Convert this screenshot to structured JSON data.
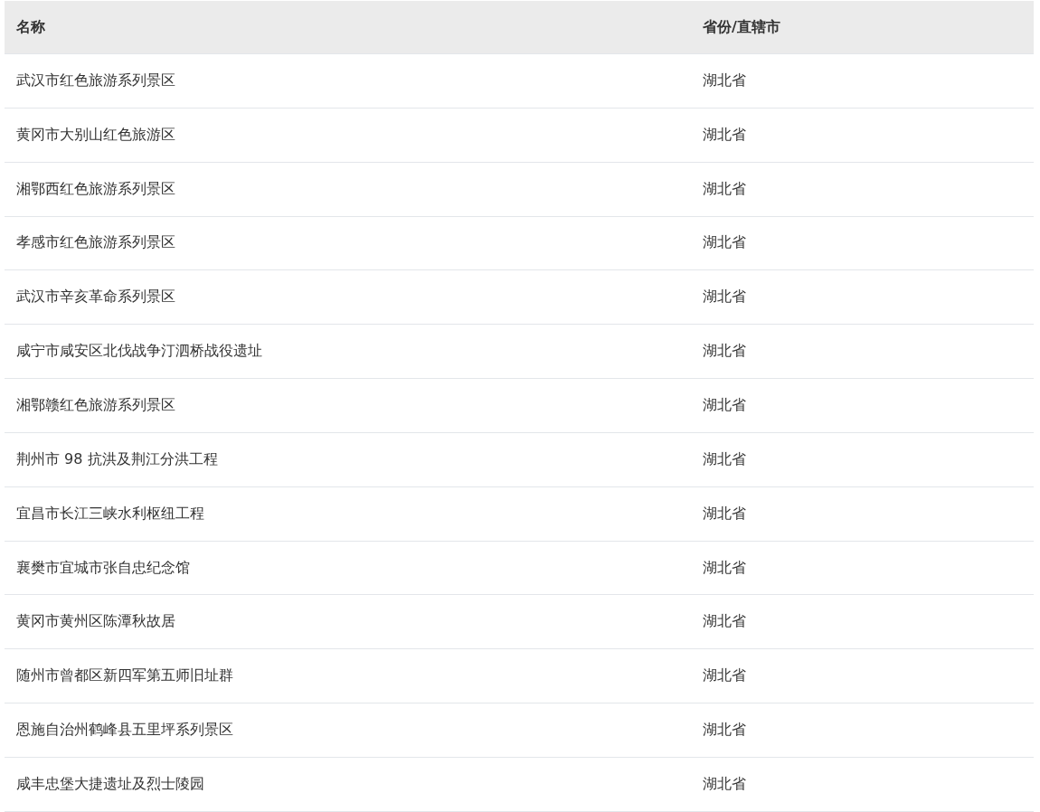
{
  "table": {
    "columns": [
      "名称",
      "省份/直辖市"
    ],
    "rows": [
      [
        "武汉市红色旅游系列景区",
        "湖北省"
      ],
      [
        "黄冈市大别山红色旅游区",
        "湖北省"
      ],
      [
        "湘鄂西红色旅游系列景区",
        "湖北省"
      ],
      [
        "孝感市红色旅游系列景区",
        "湖北省"
      ],
      [
        "武汉市辛亥革命系列景区",
        "湖北省"
      ],
      [
        "咸宁市咸安区北伐战争汀泗桥战役遗址",
        "湖北省"
      ],
      [
        "湘鄂赣红色旅游系列景区",
        "湖北省"
      ],
      [
        "荆州市 98 抗洪及荆江分洪工程",
        "湖北省"
      ],
      [
        "宜昌市长江三峡水利枢纽工程",
        "湖北省"
      ],
      [
        "襄樊市宜城市张自忠纪念馆",
        "湖北省"
      ],
      [
        "黄冈市黄州区陈潭秋故居",
        "湖北省"
      ],
      [
        "随州市曾都区新四军第五师旧址群",
        "湖北省"
      ],
      [
        "恩施自治州鹤峰县五里坪系列景区",
        "湖北省"
      ],
      [
        "咸丰忠堡大捷遗址及烈士陵园",
        "湖北省"
      ]
    ]
  }
}
